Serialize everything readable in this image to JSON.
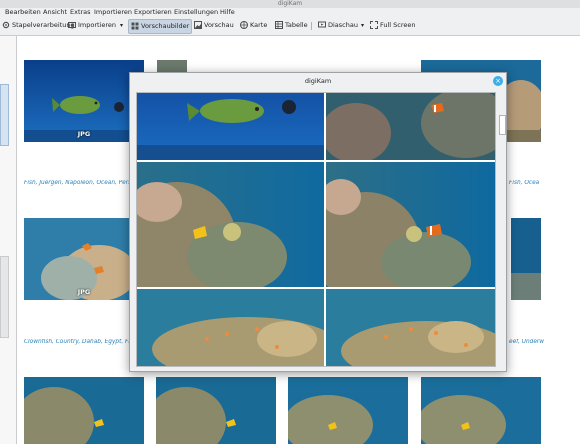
{
  "window": {
    "title": "digiKam"
  },
  "menu": [
    "Bearbeiten",
    "Ansicht",
    "Extras",
    "Importieren",
    "Exportieren",
    "Einstellungen",
    "Hilfe"
  ],
  "toolbar": {
    "batch": "Stapelverarbeitung",
    "import": "Importieren",
    "thumbnails": "Vorschaubilder",
    "preview": "Vorschau",
    "map": "Karte",
    "table": "Tabelle",
    "slideshow": "Diaschau",
    "fullscreen": "Full Screen"
  },
  "thumbnails": {
    "fmt_jpg": "JPG",
    "caption_1": "Fish, Juergen, Napoleon, Ocean, Person,",
    "caption_1_right": "Fish, Ocea",
    "caption_2": "Clownfish, Country, Dahab, Egypt, Fish, C",
    "caption_2_right": "eef, Underw"
  },
  "dialog": {
    "title": "digiKam",
    "close": "×"
  },
  "colors": {
    "selected": "#c9d5e2",
    "caption": "#2980b9",
    "accent": "#3daee9"
  }
}
